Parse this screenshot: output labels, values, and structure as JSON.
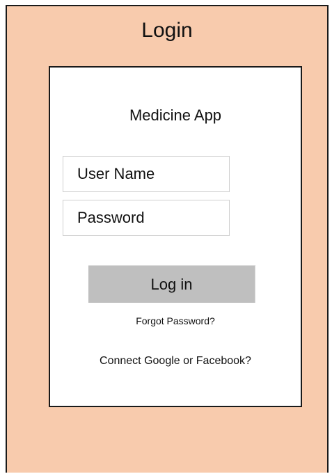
{
  "header": {
    "title": "Login"
  },
  "card": {
    "app_name": "Medicine App",
    "username": {
      "placeholder": "User Name",
      "value": ""
    },
    "password": {
      "placeholder": "Password",
      "value": ""
    },
    "login_label": "Log in",
    "forgot_label": "Forgot Password?",
    "social_label": "Connect Google or Facebook?"
  },
  "colors": {
    "background": "#f8cbad",
    "card": "#ffffff",
    "button": "#bfbfbf",
    "field_border": "#cfcfcf"
  }
}
